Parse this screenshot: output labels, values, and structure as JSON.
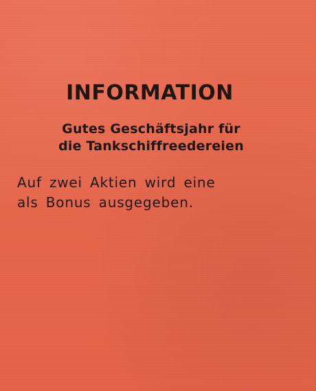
{
  "card": {
    "background_color": "#e86a4f",
    "text_color": "#1e1512",
    "title": "INFORMATION",
    "subtitle_lines": [
      "Gutes Geschäftsjahr für",
      "die Tankschiffreedereien"
    ],
    "body_lines": [
      "Auf zwei Aktien wird eine",
      "als Bonus ausgegeben."
    ]
  }
}
